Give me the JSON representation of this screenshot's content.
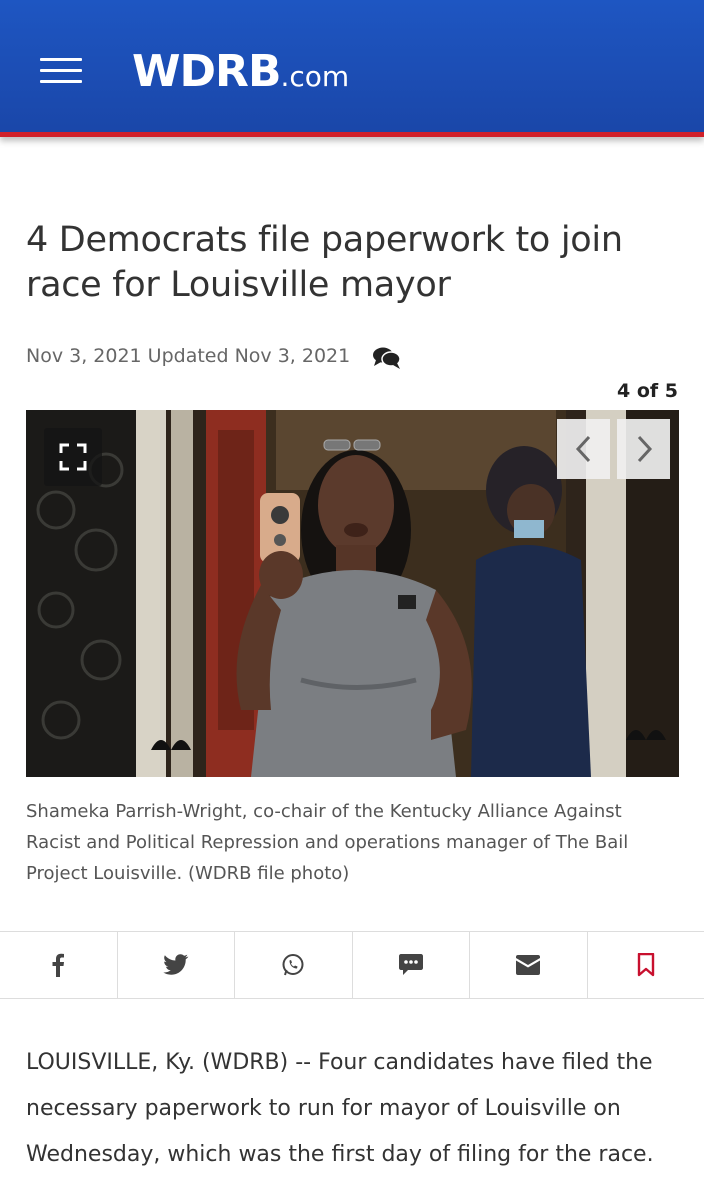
{
  "header": {
    "logo_main": "WDRB",
    "logo_suffix": ".com",
    "colors": {
      "primary": "#1e56c2",
      "accent": "#d0202a"
    }
  },
  "article": {
    "headline": "4 Democrats file paperwork to join race for Louisville mayor",
    "dateline": "Nov 3, 2021 Updated Nov 3, 2021",
    "gallery_counter": "4 of 5",
    "caption": "Shameka Parrish-Wright, co-chair of the Kentucky Alliance Against Racist and Political Repression and operations manager of The Bail Project Louisville. (WDRB file photo)",
    "body_paragraph": "LOUISVILLE, Ky. (WDRB) -- Four candidates have filed the necessary paperwork to run for mayor of Louisville on Wednesday, which was the first day of filing for the race."
  },
  "share": {
    "icons": [
      "facebook-icon",
      "twitter-icon",
      "whatsapp-icon",
      "sms-icon",
      "email-icon",
      "bookmark-icon"
    ]
  }
}
